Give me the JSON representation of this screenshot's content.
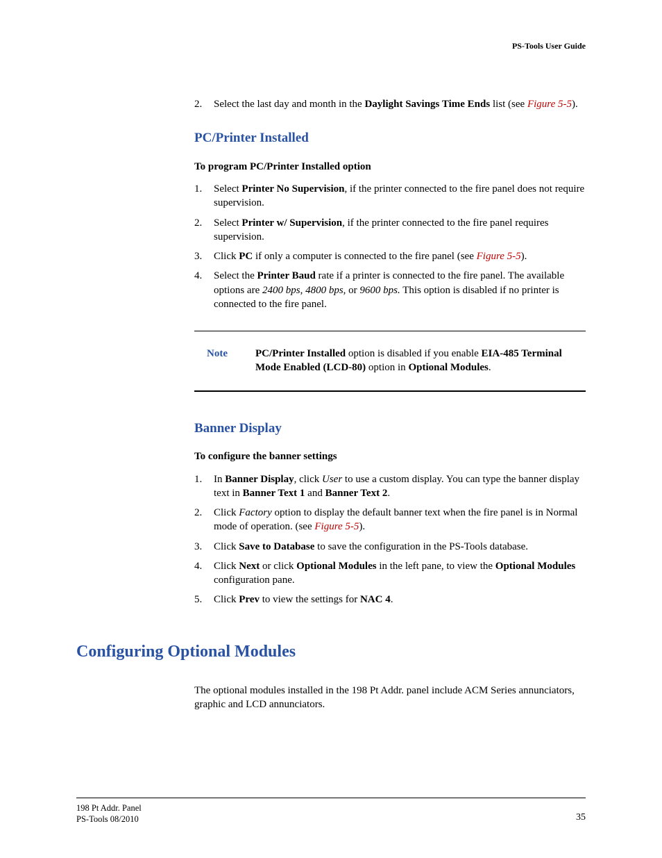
{
  "header": {
    "right": "PS-Tools User Guide"
  },
  "dst": {
    "item2": {
      "num": "2.",
      "pre": "Select the last day and month in the ",
      "bold": "Daylight Savings Time Ends",
      "mid": " list (see ",
      "fig": "Figure 5-5",
      "post": ")."
    }
  },
  "pcprinter": {
    "heading": "PC/Printer Installed",
    "sub": "To program PC/Printer Installed option",
    "i1": {
      "num": "1.",
      "pre": "Select ",
      "b1": "Printer No Supervision",
      "post": ", if the printer connected to the fire panel does not require supervision."
    },
    "i2": {
      "num": "2.",
      "pre": "Select ",
      "b1": "Printer w/ Supervision",
      "post": ", if the printer connected to the fire panel requires supervision."
    },
    "i3": {
      "num": "3.",
      "pre": "Click ",
      "b1": "PC",
      "mid": " if only a computer is connected to the fire panel (see ",
      "fig": "Figure 5-5",
      "post": ")."
    },
    "i4": {
      "num": "4.",
      "pre": "Select the ",
      "b1": "Printer Baud",
      "mid1": " rate if a printer is connected to the fire panel. The available options are ",
      "it1": "2400 bps",
      "c1": ", ",
      "it2": "4800 bps",
      "c2": ", or ",
      "it3": "9600 bps.",
      "post": " This option is disabled if no printer is connected to the fire panel."
    }
  },
  "note": {
    "label": "Note",
    "b1": "PC/Printer Installed",
    "t1": " option is disabled if you enable ",
    "b2": "EIA-485 Terminal Mode Enabled (LCD-80)",
    "t2": " option in ",
    "b3": "Optional Modules",
    "t3": "."
  },
  "banner": {
    "heading": "Banner Display",
    "sub": "To configure the banner settings",
    "i1": {
      "num": "1.",
      "pre": "In ",
      "b1": "Banner Display",
      "t1": ", click ",
      "it1": "User",
      "t2": " to use a custom display. You can type the banner display text in ",
      "b2": "Banner Text 1",
      "t3": " and ",
      "b3": "Banner Text 2",
      "t4": "."
    },
    "i2": {
      "num": "2.",
      "pre": "Click ",
      "it1": "Factory",
      "t1": " option to display the default banner text when the fire panel is in Normal mode of operation. (see ",
      "fig": "Figure 5-5",
      "post": ")."
    },
    "i3": {
      "num": "3.",
      "pre": "Click ",
      "b1": "Save to Database",
      "post": " to save the configuration in the PS-Tools database."
    },
    "i4": {
      "num": "4.",
      "pre": "Click ",
      "b1": "Next",
      "t1": " or click ",
      "b2": "Optional Modules",
      "t2": " in the left pane, to view the ",
      "b3": "Optional Modules",
      "post": " configuration pane."
    },
    "i5": {
      "num": "5.",
      "pre": "Click ",
      "b1": "Prev",
      "t1": " to view the settings for ",
      "b2": "NAC 4",
      "post": "."
    }
  },
  "optmod": {
    "heading": "Configuring Optional Modules",
    "para": "The optional modules installed in the 198 Pt Addr. panel include ACM Series annunciators, graphic and LCD annunciators."
  },
  "footer": {
    "line1": "198 Pt Addr. Panel",
    "line2": "PS-Tools  08/2010",
    "pagenum": "35"
  }
}
